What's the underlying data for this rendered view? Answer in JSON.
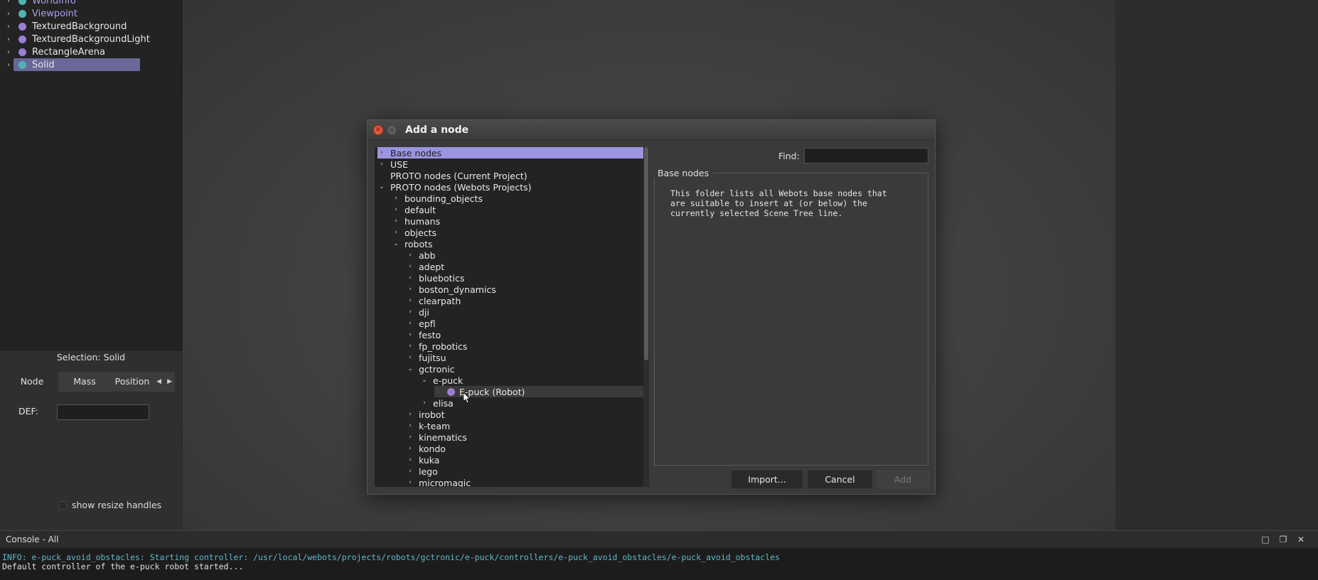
{
  "scene_tree": {
    "items": [
      {
        "label": "WorldInfo",
        "color": "#4fb3b3"
      },
      {
        "label": "Viewpoint",
        "color": "#4fb3b3"
      },
      {
        "label": "TexturedBackground",
        "color": "#9a7fd6"
      },
      {
        "label": "TexturedBackgroundLight",
        "color": "#9a7fd6"
      },
      {
        "label": "RectangleArena",
        "color": "#9a7fd6"
      },
      {
        "label": "Solid",
        "color": "#4fb3b3",
        "selected": true
      }
    ]
  },
  "field_editor": {
    "selection_title": "Selection: Solid",
    "tabs": [
      "Node",
      "Mass",
      "Position"
    ],
    "def_label": "DEF:",
    "def_value": "",
    "resize_handles_label": "show resize handles"
  },
  "dialog": {
    "title": "Add a node",
    "find_label": "Find:",
    "find_value": "",
    "info_title": "Base nodes",
    "info_text": "This folder lists all Webots base nodes that\nare suitable to insert at (or below) the\ncurrently selected Scene Tree line.",
    "buttons": {
      "import": "Import...",
      "cancel": "Cancel",
      "add": "Add"
    },
    "tree": [
      {
        "label": "Base nodes",
        "level": 0,
        "arrow": "right",
        "highlight": true
      },
      {
        "label": "USE",
        "level": 0,
        "arrow": "right"
      },
      {
        "label": "PROTO nodes (Current Project)",
        "level": 0,
        "arrow": "none"
      },
      {
        "label": "PROTO nodes (Webots Projects)",
        "level": 0,
        "arrow": "down"
      },
      {
        "label": "bounding_objects",
        "level": 1,
        "arrow": "right"
      },
      {
        "label": "default",
        "level": 1,
        "arrow": "right"
      },
      {
        "label": "humans",
        "level": 1,
        "arrow": "right"
      },
      {
        "label": "objects",
        "level": 1,
        "arrow": "right"
      },
      {
        "label": "robots",
        "level": 1,
        "arrow": "down"
      },
      {
        "label": "abb",
        "level": 2,
        "arrow": "right"
      },
      {
        "label": "adept",
        "level": 2,
        "arrow": "right"
      },
      {
        "label": "bluebotics",
        "level": 2,
        "arrow": "right"
      },
      {
        "label": "boston_dynamics",
        "level": 2,
        "arrow": "right"
      },
      {
        "label": "clearpath",
        "level": 2,
        "arrow": "right"
      },
      {
        "label": "dji",
        "level": 2,
        "arrow": "right"
      },
      {
        "label": "epfl",
        "level": 2,
        "arrow": "right"
      },
      {
        "label": "festo",
        "level": 2,
        "arrow": "right"
      },
      {
        "label": "fp_robotics",
        "level": 2,
        "arrow": "right"
      },
      {
        "label": "fujitsu",
        "level": 2,
        "arrow": "right"
      },
      {
        "label": "gctronic",
        "level": 2,
        "arrow": "down"
      },
      {
        "label": "e-puck",
        "level": 3,
        "arrow": "down"
      },
      {
        "label": "E-puck (Robot)",
        "level": 4,
        "arrow": "none",
        "node": true,
        "selected": true
      },
      {
        "label": "elisa",
        "level": 3,
        "arrow": "right"
      },
      {
        "label": "irobot",
        "level": 2,
        "arrow": "right"
      },
      {
        "label": "k-team",
        "level": 2,
        "arrow": "right"
      },
      {
        "label": "kinematics",
        "level": 2,
        "arrow": "right"
      },
      {
        "label": "kondo",
        "level": 2,
        "arrow": "right"
      },
      {
        "label": "kuka",
        "level": 2,
        "arrow": "right"
      },
      {
        "label": "lego",
        "level": 2,
        "arrow": "right"
      },
      {
        "label": "micromagic",
        "level": 2,
        "arrow": "right"
      }
    ]
  },
  "console": {
    "title": "Console - All",
    "lines": [
      {
        "text": "INFO: e-puck_avoid_obstacles: Starting controller: /usr/local/webots/projects/robots/gctronic/e-puck/controllers/e-puck_avoid_obstacles/e-puck_avoid_obstacles",
        "color": "#5fb8c9"
      },
      {
        "text": "Default controller of the e-puck robot started...",
        "color": "#e0e0e0"
      }
    ]
  }
}
